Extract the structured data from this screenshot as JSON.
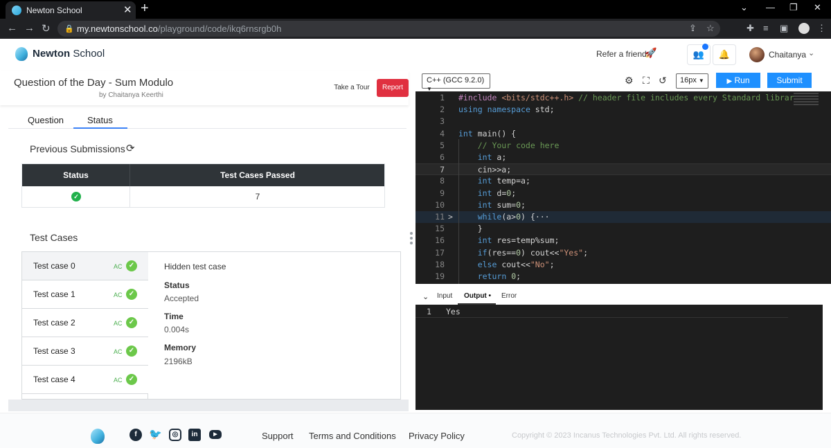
{
  "browser": {
    "tab_title": "Newton School",
    "url_host": "my.newtonschool.co",
    "url_path": "/playground/code/ikq6rnsrgb0h"
  },
  "header": {
    "brand_bold": "Newton",
    "brand_light": "School",
    "refer": "Refer a friend",
    "user": "Chaitanya"
  },
  "question": {
    "title": "Question of the Day - Sum Modulo",
    "author": "by Chaitanya Keerthi",
    "tour": "Take a Tour",
    "report": "Report"
  },
  "tabs": [
    "Question",
    "Status"
  ],
  "submissions": {
    "title": "Previous Submissions",
    "headers": [
      "Status",
      "Test Cases Passed"
    ],
    "rows": [
      {
        "status": "accepted",
        "passed": "7"
      }
    ]
  },
  "testcases": {
    "title": "Test Cases",
    "items": [
      {
        "name": "Test case 0",
        "verdict": "AC"
      },
      {
        "name": "Test case 1",
        "verdict": "AC"
      },
      {
        "name": "Test case 2",
        "verdict": "AC"
      },
      {
        "name": "Test case 3",
        "verdict": "AC"
      },
      {
        "name": "Test case 4",
        "verdict": "AC"
      }
    ],
    "detail": {
      "hidden": "Hidden test case",
      "status_label": "Status",
      "status": "Accepted",
      "time_label": "Time",
      "time": "0.004s",
      "memory_label": "Memory",
      "memory": "2196kB"
    }
  },
  "editor": {
    "language": "C++ (GCC 9.2.0)",
    "font_size": "16px",
    "run": "Run",
    "submit": "Submit",
    "lines": [
      {
        "n": "1",
        "code": "#include <bits/stdc++.h> // header file includes every Standard librar"
      },
      {
        "n": "2",
        "code": "using namespace std;"
      },
      {
        "n": "3",
        "code": ""
      },
      {
        "n": "4",
        "code": "int main() {"
      },
      {
        "n": "5",
        "code": "    // Your code here"
      },
      {
        "n": "6",
        "code": "    int a;"
      },
      {
        "n": "7",
        "code": "    cin>>a;"
      },
      {
        "n": "8",
        "code": "    int temp=a;"
      },
      {
        "n": "9",
        "code": "    int d=0;"
      },
      {
        "n": "10",
        "code": "    int sum=0;"
      },
      {
        "n": "11",
        "code": "    while(a>0) {···"
      },
      {
        "n": "15",
        "code": "    }"
      },
      {
        "n": "16",
        "code": "    int res=temp%sum;"
      },
      {
        "n": "17",
        "code": "    if(res==0) cout<<\"Yes\";"
      },
      {
        "n": "18",
        "code": "    else cout<<\"No\";"
      },
      {
        "n": "19",
        "code": "    return 0;"
      }
    ]
  },
  "io": {
    "tabs": [
      "Input",
      "Output",
      "Error"
    ],
    "output_line_no": "1",
    "output": "Yes"
  },
  "footer": {
    "links": [
      "Support",
      "Terms and Conditions",
      "Privacy Policy"
    ],
    "copyright": "Copyright © 2023 Incanus Technologies Pvt. Ltd. All rights reserved."
  },
  "colors": {
    "accent": "#1e90ff",
    "report": "#e03040",
    "success": "#22b14c",
    "editor_bg": "#1e1e1e"
  }
}
